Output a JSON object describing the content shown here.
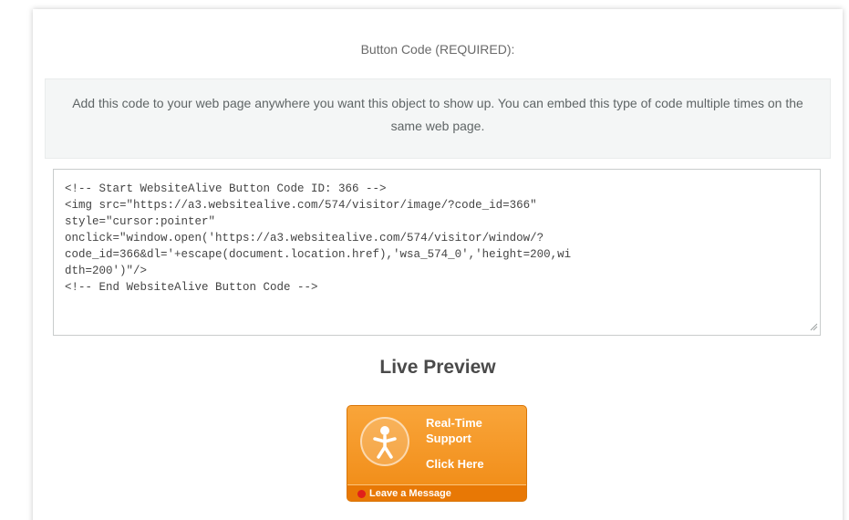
{
  "section": {
    "heading": "Button Code (REQUIRED):",
    "instructions": "Add this code to your web page anywhere you want this object to show up. You can embed this type of code multiple times on the same web page."
  },
  "code": {
    "value": "<!-- Start WebsiteAlive Button Code ID: 366 -->\n<img src=\"https://a3.websitealive.com/574/visitor/image/?code_id=366\"\nstyle=\"cursor:pointer\"\nonclick=\"window.open('https://a3.websitealive.com/574/visitor/window/?\ncode_id=366&dl='+escape(document.location.href),'wsa_574_0','height=200,wi\ndth=200')\"/>\n<!-- End WebsiteAlive Button Code -->"
  },
  "preview": {
    "title": "Live Preview",
    "button": {
      "line1": "Real-Time",
      "line2": "Support",
      "line3": "Click Here",
      "footer": "Leave a Message",
      "icon": "person-icon"
    }
  },
  "colors": {
    "button_orange": "#f39a25",
    "status_red": "#e0201b"
  }
}
